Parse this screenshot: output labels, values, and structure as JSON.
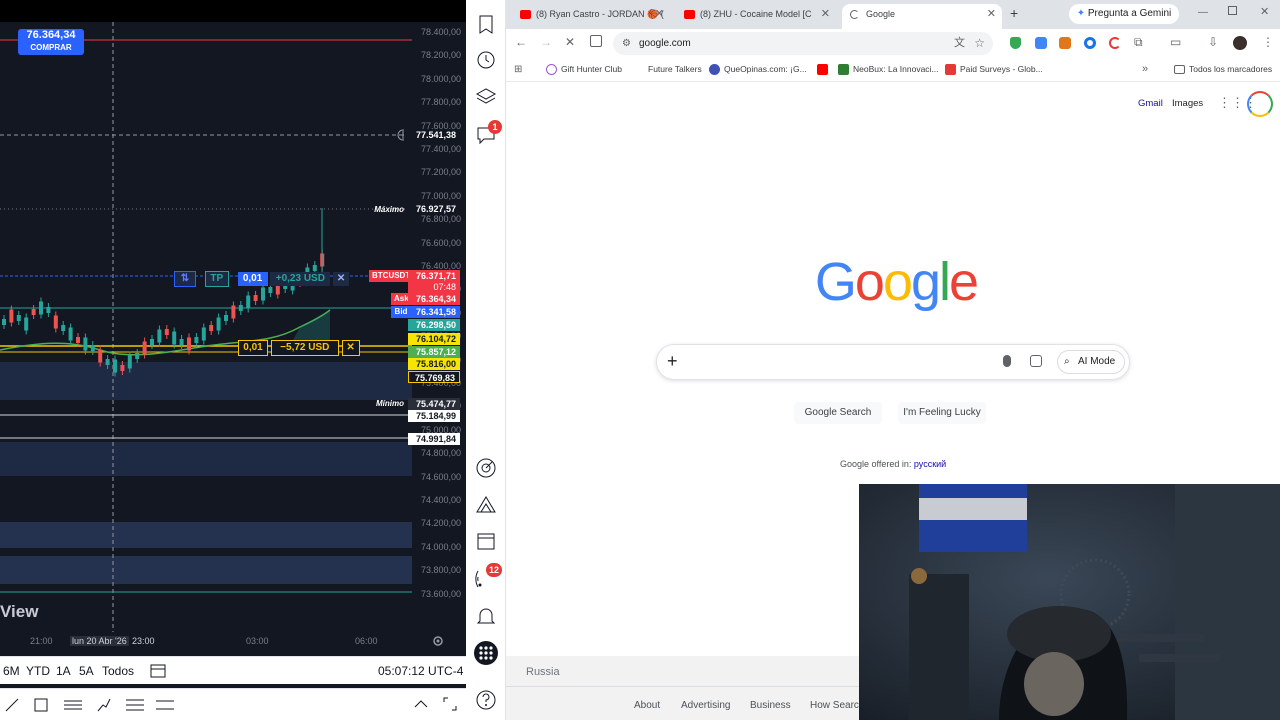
{
  "chart": {
    "buy_price": "76.364,34",
    "buy_label": "COMPRAR",
    "price_axis": [
      "78.400,00",
      "78.200,00",
      "78.000,00",
      "77.800,00",
      "77.600,00",
      "77.400,00",
      "77.200,00",
      "77.000,00",
      "76.800,00",
      "76.600,00",
      "76.400,00",
      "76.200,00",
      "76.000,00",
      "75.800,00",
      "75.600,00",
      "75.400,00",
      "75.200,00",
      "75.000,00",
      "74.800,00",
      "74.600,00",
      "74.400,00",
      "74.200,00",
      "74.000,00",
      "73.800,00",
      "73.600,00"
    ],
    "crosshair_price": "77.541,38",
    "max_label": "Máximo",
    "max_price": "76.927,57",
    "symbol_tag": "BTCUSDT",
    "last_price": "76.371,71",
    "countdown": "07:48",
    "ask_label": "Ask",
    "ask_price": "76.364,34",
    "bid_label": "Bid",
    "bid_price": "76.341,58",
    "level_1": "76.298,50",
    "level_2": "76.104,72",
    "level_3": "75.857,12",
    "level_4": "75.816,00",
    "level_5": "75.769,83",
    "min_label": "Mínimo",
    "min_price": "75.474,77",
    "level_6": "75.184,99",
    "level_7": "74.991,84",
    "tp_order": {
      "toggle": "⇅",
      "tp": "TP",
      "qty": "0,01",
      "pnl": "+0,23 USD",
      "close": "✕"
    },
    "sl_order": {
      "qty": "0,01",
      "pnl": "−5,72 USD",
      "close": "✕"
    },
    "watermark": "View",
    "time_labels": [
      "21:00",
      "lun 20 Abr '26",
      "23:00",
      "03:00",
      "06:00"
    ],
    "ranges": [
      "6M",
      "YTD",
      "1A",
      "5A",
      "Todos"
    ],
    "clock": "05:07:12 UTC-4",
    "colors": {
      "up": "#26a69a",
      "down": "#ef5350",
      "accent": "#2962ff"
    }
  },
  "sidebar_badges": {
    "chat": "1",
    "feed": "12"
  },
  "browser": {
    "tabs": [
      {
        "title": "(8) Ryan Castro - JORDAN 🏀 (",
        "icon": "youtube-icon"
      },
      {
        "title": "(8) ZHU - Cocaine Model [C",
        "icon": "youtube-icon"
      },
      {
        "title": "Google",
        "icon": "loading-icon"
      }
    ],
    "new_tab": "+",
    "gemini": "Pregunta a Gemini",
    "url": "google.com",
    "bookmarks": [
      "Gift Hunter Club",
      "Future Talkers",
      "QueOpinas.com: ¡G...",
      "",
      "NeoBux: La Innovaci...",
      "Paid Surveys - Glob..."
    ],
    "bookmarks_more": "»",
    "all_bookmarks": "Todos los marcadores"
  },
  "google": {
    "gmail": "Gmail",
    "images": "Images",
    "logo_letters": [
      "G",
      "o",
      "o",
      "g",
      "l",
      "e"
    ],
    "logo_colors": [
      "#4285f4",
      "#ea4335",
      "#fbbc05",
      "#4285f4",
      "#34a853",
      "#ea4335"
    ],
    "ai_mode": "AI Mode",
    "search_button": "Google Search",
    "lucky_button": "I'm Feeling Lucky",
    "offered_in": "Google offered in:",
    "language": "русский",
    "country": "Russia",
    "footer_links": [
      "About",
      "Advertising",
      "Business",
      "How Search"
    ]
  }
}
